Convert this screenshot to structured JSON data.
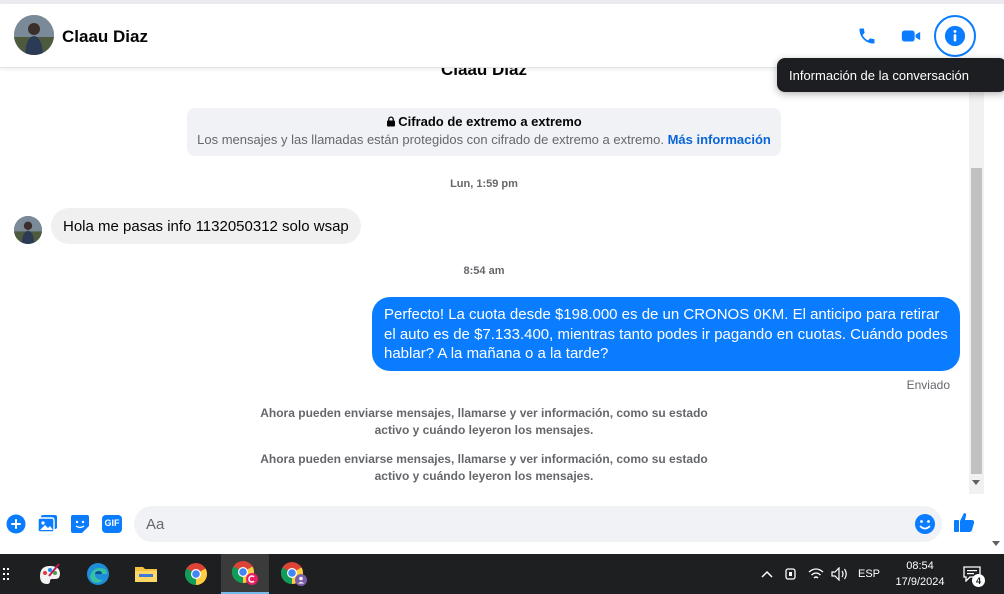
{
  "header": {
    "contact_name": "Claau Diaz",
    "tooltip": "Información de la conversación"
  },
  "thread": {
    "name_heading": "Claau Diaz",
    "e2e": {
      "title": "Cifrado de extremo a extremo",
      "description": "Los mensajes y las llamadas están protegidos con cifrado de extremo a extremo.",
      "link": "Más información"
    },
    "time_1": "Lun, 1:59 pm",
    "incoming_message": "Hola me pasas info 1132050312 solo wsap",
    "time_2": "8:54 am",
    "outgoing_message": "Perfecto! La cuota desde $198.000 es de un CRONOS 0KM. El anticipo para retirar el auto es de $7.133.400, mientras tanto podes ir pagando en cuotas. Cuándo podes hablar? A la mañana o a la tarde?",
    "sent_status": "Enviado",
    "system_message_1": "Ahora pueden enviarse mensajes, llamarse y ver información, como su estado activo y cuándo leyeron los mensajes.",
    "system_message_2": "Ahora pueden enviarse mensajes, llamarse y ver información, como su estado activo y cuándo leyeron los mensajes."
  },
  "composer": {
    "placeholder": "Aa",
    "gif_label": "GIF",
    "icons": [
      "plus-circle-icon",
      "image-icon",
      "sticker-icon",
      "gif-icon",
      "emoji-icon",
      "thumbs-up-icon"
    ]
  },
  "taskbar": {
    "language": "ESP",
    "time": "08:54",
    "date": "17/9/2024",
    "notification_count": "4"
  },
  "colors": {
    "accent": "#0a7cff",
    "incoming_bubble": "#f0f0f0",
    "e2e_box": "#f0f2f5",
    "taskbar": "#1e1f20"
  }
}
